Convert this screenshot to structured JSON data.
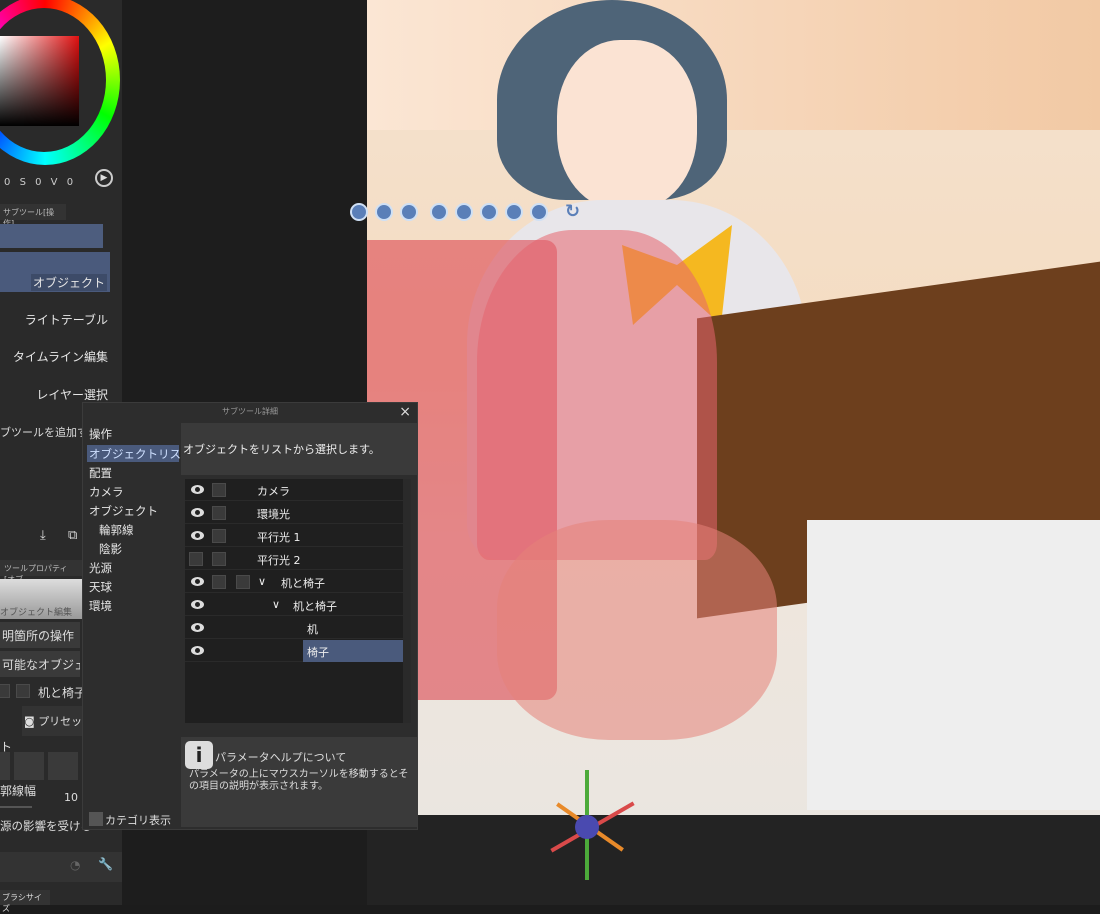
{
  "color_panel": {
    "values": [
      "0",
      "S",
      "0",
      "V",
      "0"
    ]
  },
  "subtool_panel": {
    "tab": "サブツール[操作]",
    "items": [
      "オブジェクト",
      "ライトテーブル",
      "タイムライン編集",
      "レイヤー選択"
    ],
    "add_label": "ブツールを追加す"
  },
  "tool_property": {
    "tab": "ツールプロパティ[オブ",
    "preview_label": "オブジェクト編集",
    "buttons": [
      "明箇所の操作",
      "可能なオブジェク"
    ],
    "object_name": "机と椅子",
    "preset": "プリセッ",
    "section": "ト",
    "outline_label": "郭線幅",
    "outline_value": "10",
    "affect_label": "源の影響を受ける",
    "brush_size_tab": "ブラシサイズ"
  },
  "dialog": {
    "title": "サブツール詳細",
    "close": "×",
    "categories": [
      "操作",
      "オブジェクトリスト",
      "配置",
      "カメラ",
      "オブジェクト",
      "輪郭線",
      "陰影",
      "光源",
      "天球",
      "環境"
    ],
    "selected_category": "オブジェクトリスト",
    "description": "オブジェクトをリストから選択します。",
    "object_list": [
      {
        "label": "カメラ",
        "visible": true
      },
      {
        "label": "環境光",
        "visible": true
      },
      {
        "label": "平行光 1",
        "visible": true
      },
      {
        "label": "平行光 2",
        "visible": false
      },
      {
        "label": "机と椅子",
        "visible": true
      },
      {
        "label": "机と椅子",
        "visible": true
      },
      {
        "label": "机",
        "visible": true
      },
      {
        "label": "椅子",
        "visible": true,
        "selected": true
      }
    ],
    "help_title": "パラメータヘルプについて",
    "help_text": "パラメータの上にマウスカーソルを移動するとその項目の説明が表示されます。",
    "category_display": "カテゴリ表示"
  },
  "colors": {
    "accent": "#4a5a7c",
    "panel": "#2a2a2a",
    "dialog": "#2d2d2d"
  }
}
